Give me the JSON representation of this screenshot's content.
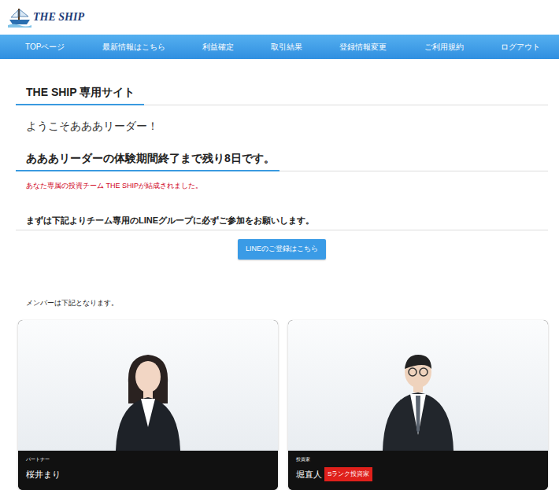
{
  "logo": {
    "text": "THE SHIP"
  },
  "nav": [
    "TOPページ",
    "最新情報はこちら",
    "利益確定",
    "取引結果",
    "登録情報変更",
    "ご利用規約",
    "ログアウト"
  ],
  "page_title": "THE SHIP 専用サイト",
  "welcome": "ようこそあああリーダー！",
  "trial_notice": "あああリーダーの体験期間終了まで残り8日です。",
  "team_notice": "あなた専属の投資チーム THE SHIPが結成されました。",
  "line_instruction": "まずは下記よりチーム専用のLINEグループに必ずご参加をお願いします。",
  "line_button": "LINEのご登録はこちら",
  "members_intro": "メンバーは下記となります。",
  "members": [
    {
      "role": "パートナー",
      "name": "桜井まり",
      "kind": "female"
    },
    {
      "role": "投資家",
      "name": "堀直人",
      "badge": "Sランク投資家",
      "kind": "male"
    }
  ]
}
